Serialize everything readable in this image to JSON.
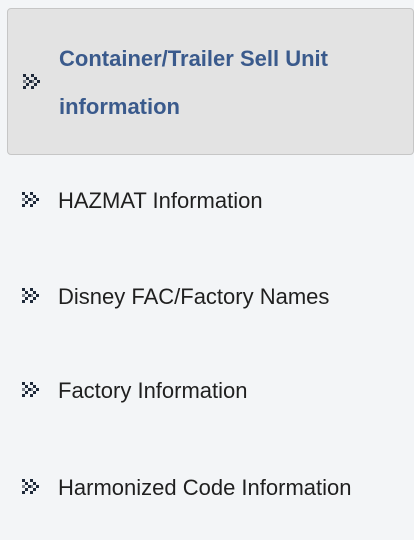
{
  "nav": {
    "items": [
      {
        "label": "Container/Trailer Sell Unit information",
        "active": true
      },
      {
        "label": "HAZMAT Information",
        "active": false
      },
      {
        "label": "Disney FAC/Factory Names",
        "active": false
      },
      {
        "label": "Factory Information",
        "active": false
      },
      {
        "label": "Harmonized Code Information",
        "active": false
      }
    ]
  },
  "icons": {
    "item_icon": "double-chevron-right-icon"
  },
  "colors": {
    "active_text": "#3a5a8c",
    "active_background": "#e3e3e3",
    "icon": "#1f2a3a",
    "page_background": "#f3f5f7"
  }
}
